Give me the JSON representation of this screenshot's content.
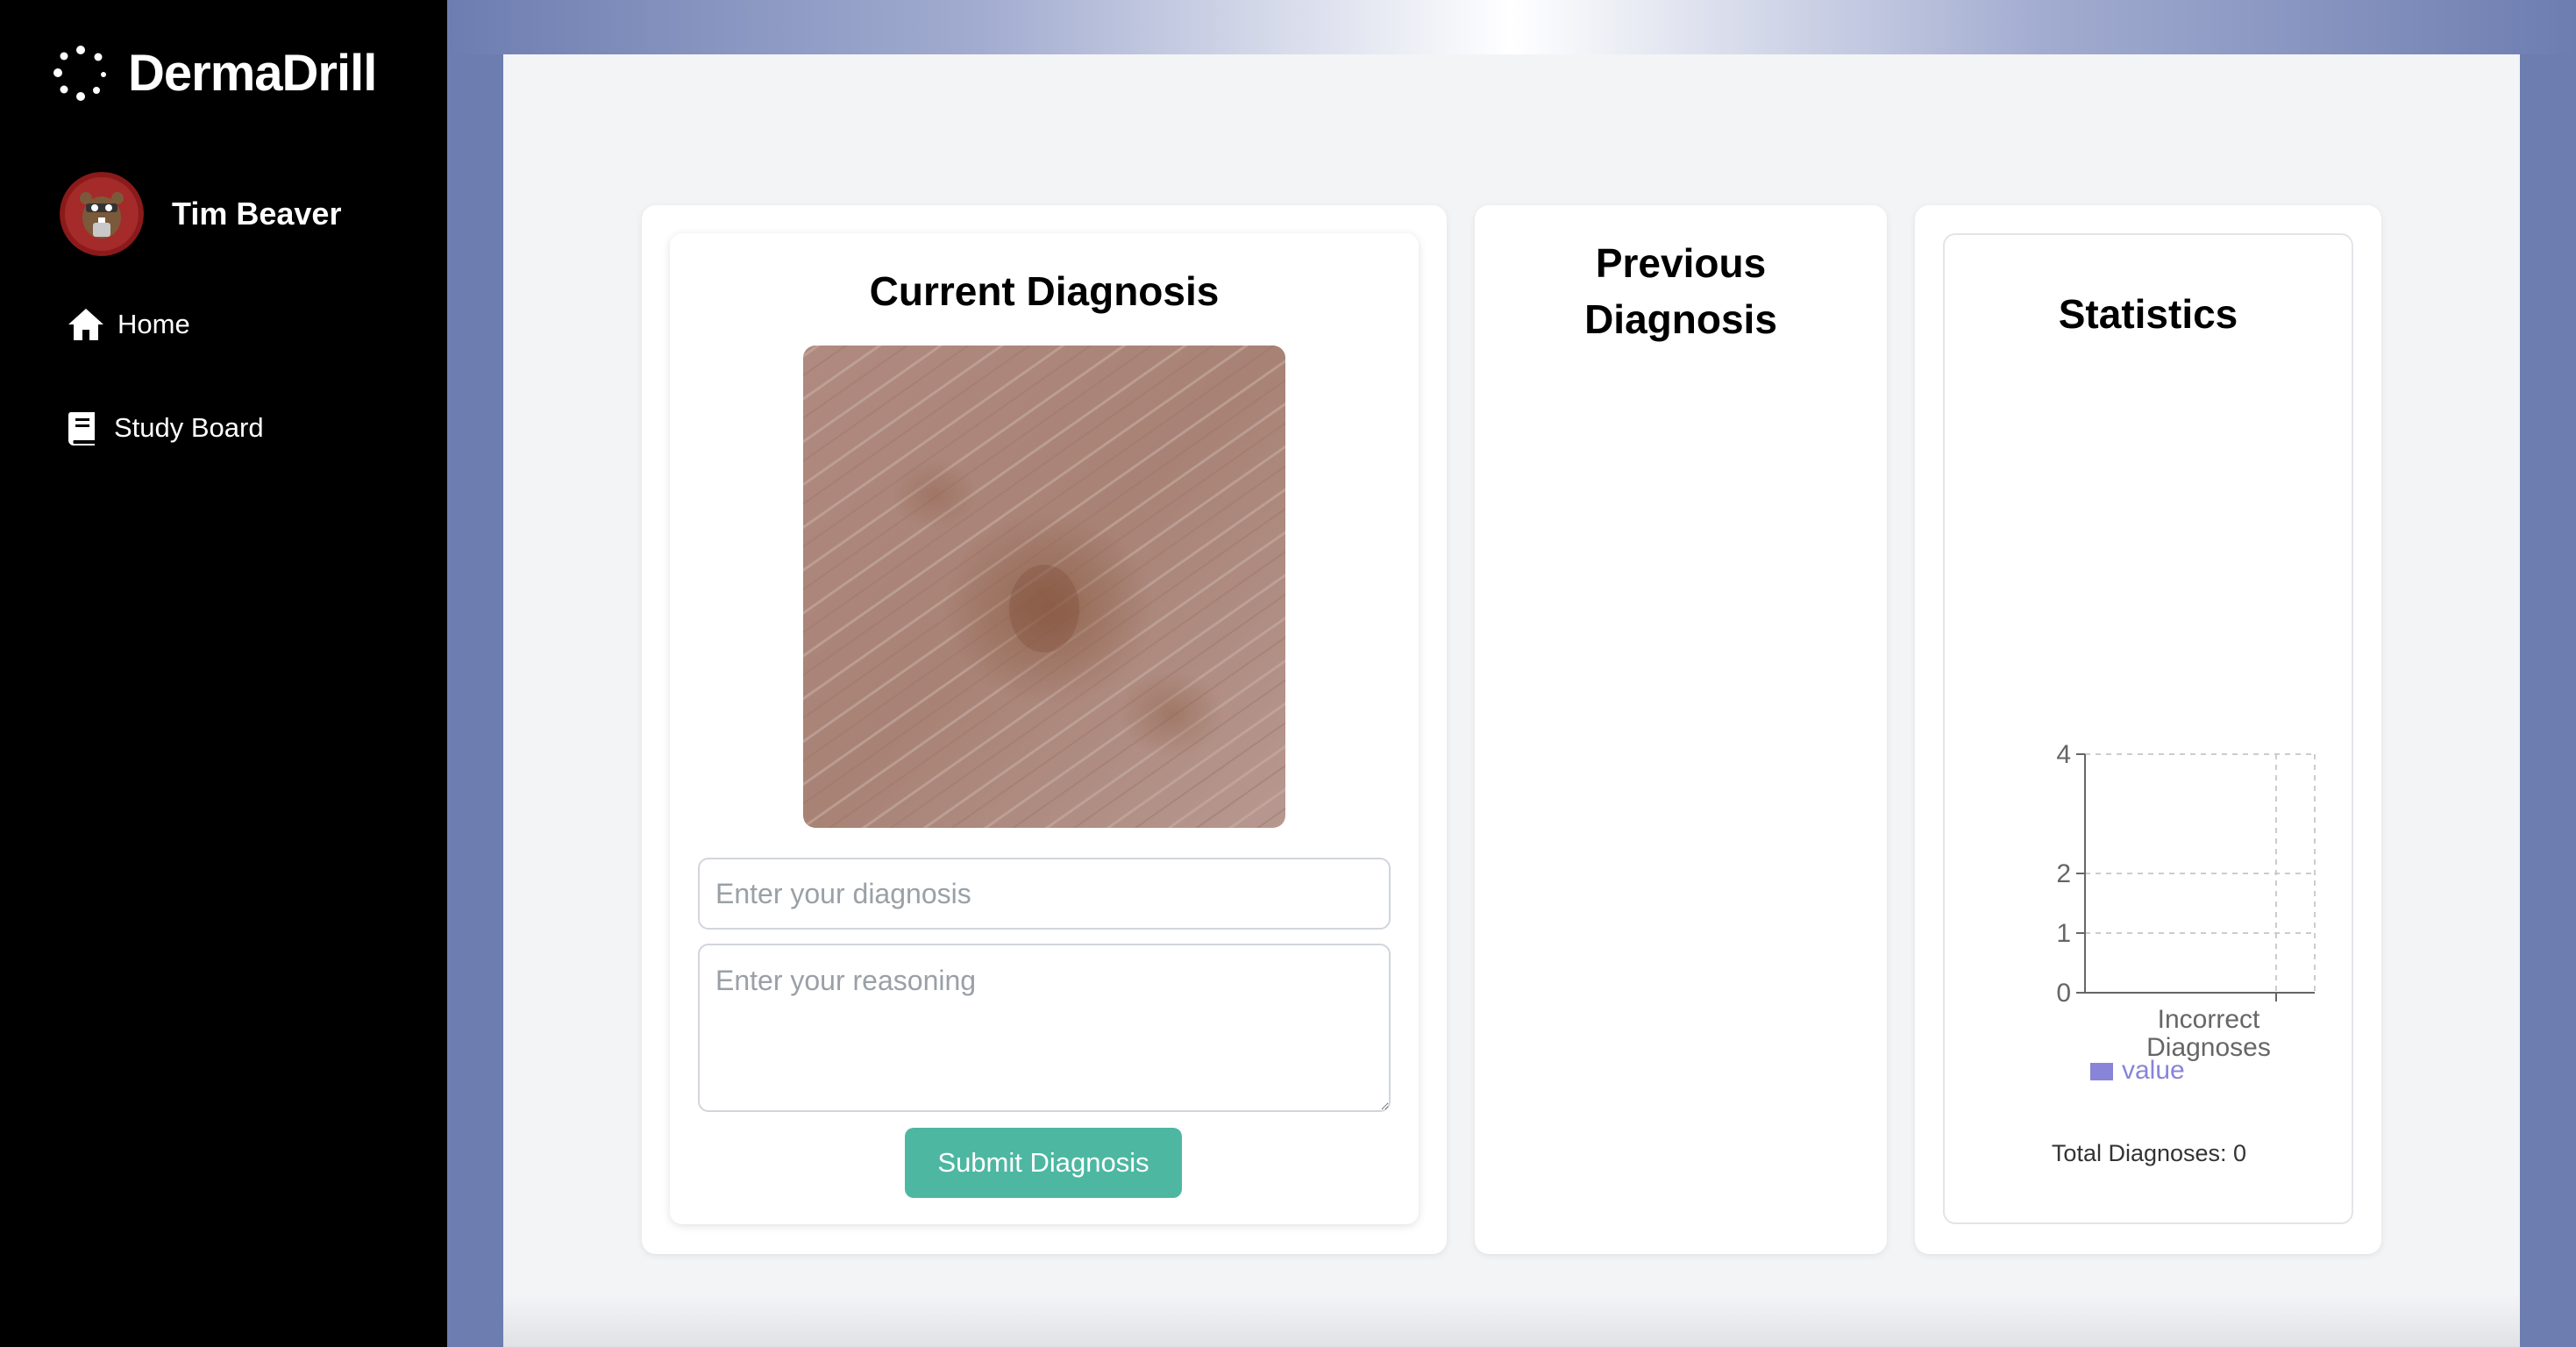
{
  "app": {
    "name": "DermaDrill"
  },
  "user": {
    "name": "Tim Beaver"
  },
  "nav": {
    "home": "Home",
    "study_board": "Study Board"
  },
  "current": {
    "title": "Current Diagnosis",
    "diagnosis_placeholder": "Enter your diagnosis",
    "reasoning_placeholder": "Enter your reasoning",
    "submit_label": "Submit Diagnosis"
  },
  "previous": {
    "title_line1": "Previous",
    "title_line2": "Diagnosis"
  },
  "statistics": {
    "title": "Statistics",
    "total_label": "Total Diagnoses: 0"
  },
  "chart_data": {
    "type": "bar",
    "categories": [
      "Incorrect Diagnoses"
    ],
    "category_lines": [
      "Incorrect",
      "Diagnoses"
    ],
    "series": [
      {
        "name": "value",
        "values": [
          0
        ],
        "color": "#8884d8"
      }
    ],
    "yticks": [
      0,
      1,
      2,
      4
    ],
    "ylim": [
      0,
      4
    ],
    "grid": true,
    "legend": "bottom"
  },
  "colors": {
    "accent": "#4db7a2",
    "sidebar": "#000000",
    "background": "#6d7db0",
    "series": "#8884d8"
  }
}
